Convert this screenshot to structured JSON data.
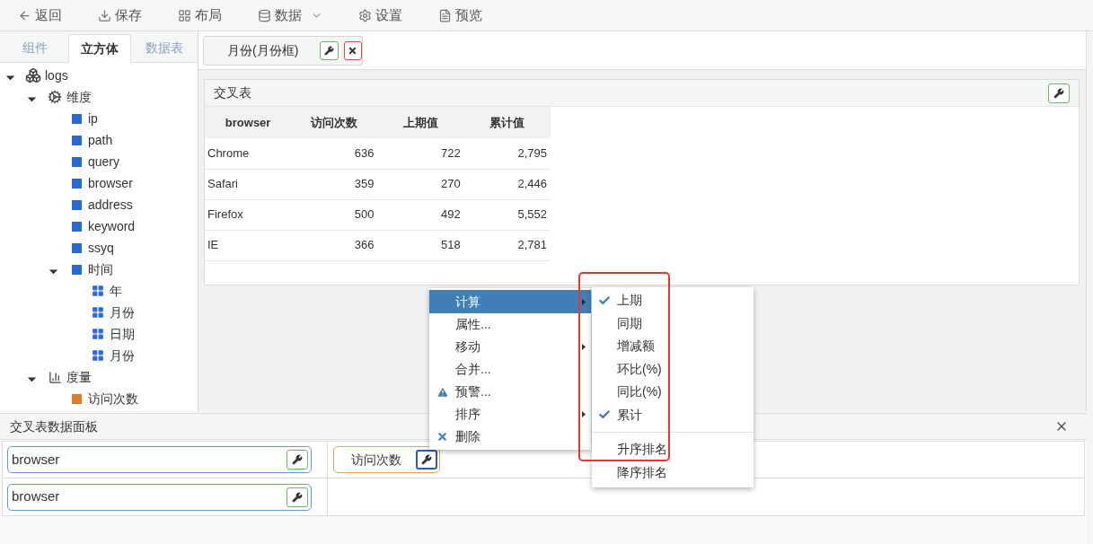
{
  "toolbar": [
    {
      "label": "返回",
      "dropdown": false
    },
    {
      "label": "保存",
      "dropdown": false
    },
    {
      "label": "布局",
      "dropdown": false
    },
    {
      "label": "数据",
      "dropdown": true
    },
    {
      "label": "设置",
      "dropdown": false
    },
    {
      "label": "预览",
      "dropdown": false
    }
  ],
  "left_panel": {
    "tabs": [
      {
        "label": "组件",
        "selected": false
      },
      {
        "label": "立方体",
        "selected": true
      },
      {
        "label": "数据表",
        "selected": false
      }
    ],
    "tree": [
      {
        "label": "logs",
        "kind": "cube",
        "expanded": true,
        "children": [
          {
            "label": "维度",
            "kind": "dimensions",
            "expanded": true,
            "children": [
              {
                "label": "ip",
                "kind": "attribute"
              },
              {
                "label": "path",
                "kind": "attribute"
              },
              {
                "label": "query",
                "kind": "attribute"
              },
              {
                "label": "browser",
                "kind": "attribute"
              },
              {
                "label": "address",
                "kind": "attribute"
              },
              {
                "label": "keyword",
                "kind": "attribute"
              },
              {
                "label": "ssyq",
                "kind": "attribute"
              },
              {
                "label": "时间",
                "kind": "attribute",
                "expanded": true,
                "children": [
                  {
                    "label": "年",
                    "kind": "level"
                  },
                  {
                    "label": "月份",
                    "kind": "level"
                  },
                  {
                    "label": "日期",
                    "kind": "level"
                  },
                  {
                    "label": "月份",
                    "kind": "level"
                  }
                ]
              }
            ]
          },
          {
            "label": "度量",
            "kind": "measures",
            "expanded": true,
            "children": [
              {
                "label": "访问次数",
                "kind": "measure"
              }
            ]
          }
        ]
      }
    ]
  },
  "filter_bar": {
    "chips": [
      {
        "label": "月份(月份框)"
      }
    ]
  },
  "crosstab": {
    "title": "交叉表",
    "columns": [
      "browser",
      "访问次数",
      "上期值",
      "累计值"
    ],
    "rows": [
      [
        "Chrome",
        "636",
        "722",
        "2,795"
      ],
      [
        "Safari",
        "359",
        "270",
        "2,446"
      ],
      [
        "Firefox",
        "500",
        "492",
        "5,552"
      ],
      [
        "IE",
        "366",
        "518",
        "2,781"
      ]
    ]
  },
  "data_panel": {
    "title": "交叉表数据面板",
    "rows": [
      {
        "field": "browser",
        "measures": [
          "访问次数"
        ]
      },
      {
        "field": "browser"
      }
    ]
  },
  "context_menu": {
    "items": [
      {
        "label": "计算",
        "kind": "plain",
        "submenu": true,
        "selected": true
      },
      {
        "label": "属性...",
        "kind": "plain",
        "submenu": false,
        "selected": false
      },
      {
        "label": "移动",
        "kind": "plain",
        "submenu": true,
        "selected": false
      },
      {
        "label": "合并...",
        "kind": "plain",
        "submenu": false,
        "selected": false
      },
      {
        "label": "预警...",
        "kind": "warning",
        "submenu": false,
        "selected": false
      },
      {
        "label": "排序",
        "kind": "plain",
        "submenu": true,
        "selected": false
      },
      {
        "label": "删除",
        "kind": "delete",
        "submenu": false,
        "selected": false
      }
    ]
  },
  "submenu": {
    "items": [
      {
        "label": "上期",
        "checked": true,
        "separator_before": false
      },
      {
        "label": "同期",
        "checked": false,
        "separator_before": false
      },
      {
        "label": "增减额",
        "checked": false,
        "separator_before": false
      },
      {
        "label": "环比(%)",
        "checked": false,
        "separator_before": false
      },
      {
        "label": "同比(%)",
        "checked": false,
        "separator_before": false
      },
      {
        "label": "累计",
        "checked": true,
        "separator_before": false
      },
      {
        "label": "升序排名",
        "checked": false,
        "separator_before": true
      },
      {
        "label": "降序排名",
        "checked": false,
        "separator_before": false
      }
    ]
  }
}
